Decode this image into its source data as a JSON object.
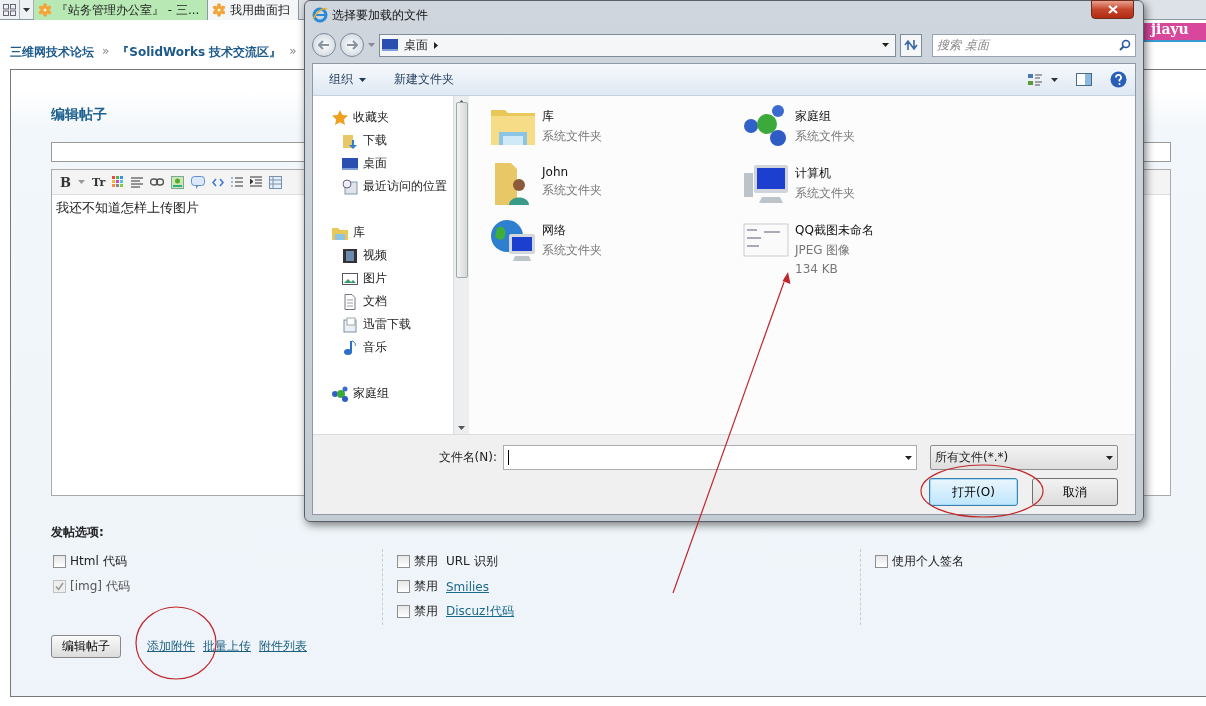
{
  "browser_tabs": [
    {
      "label": "『站务管理办公室』 - 三...",
      "selected": true
    },
    {
      "label": "我用曲面扫",
      "selected": false
    }
  ],
  "banner": {
    "text": "jiayu"
  },
  "breadcrumb": {
    "items": [
      "三维网技术论坛",
      "『SolidWorks 技术交流区』"
    ],
    "separator": "»"
  },
  "editor": {
    "title": "编辑帖子",
    "toolbar_labels": [
      "B",
      "Tr"
    ],
    "content": "我还不知道怎样上传图片"
  },
  "options": {
    "heading": "发帖选项:",
    "columns": [
      [
        {
          "label": "Html 代码",
          "checked": false,
          "disabled": false,
          "link": false
        },
        {
          "label": "[img] 代码",
          "checked": true,
          "disabled": true,
          "link": false
        }
      ],
      [
        {
          "prefix": "禁用",
          "label": "URL 识别",
          "checked": false,
          "disabled": false,
          "link": false
        },
        {
          "prefix": "禁用",
          "label": "Smilies",
          "checked": false,
          "disabled": false,
          "link": true
        },
        {
          "prefix": "禁用",
          "label": "Discuz!代码",
          "checked": false,
          "disabled": false,
          "link": true
        }
      ],
      [
        {
          "label": "使用个人签名",
          "checked": false,
          "disabled": false,
          "link": false
        }
      ]
    ]
  },
  "submit_button": "编辑帖子",
  "attachment_links": [
    "添加附件",
    "批量上传",
    "附件列表"
  ],
  "dialog": {
    "title": "选择要加载的文件",
    "address": "桌面",
    "search_placeholder": "搜索 桌面",
    "toolbar": [
      {
        "label": "组织",
        "menu": true
      },
      {
        "label": "新建文件夹",
        "menu": false
      }
    ],
    "nav": [
      {
        "label": "收藏夹",
        "kind": "favorites",
        "children": [
          {
            "label": "下载",
            "kind": "download"
          },
          {
            "label": "桌面",
            "kind": "desktop"
          },
          {
            "label": "最近访问的位置",
            "kind": "recent"
          }
        ]
      },
      {
        "label": "库",
        "kind": "library",
        "children": [
          {
            "label": "视频",
            "kind": "video"
          },
          {
            "label": "图片",
            "kind": "pictures"
          },
          {
            "label": "文档",
            "kind": "documents"
          },
          {
            "label": "迅雷下载",
            "kind": "downloads-library"
          },
          {
            "label": "音乐",
            "kind": "music"
          }
        ]
      },
      {
        "label": "家庭组",
        "kind": "homegroup"
      }
    ],
    "files": [
      {
        "name": "库",
        "details": [
          "系统文件夹"
        ],
        "kind": "library"
      },
      {
        "name": "家庭组",
        "details": [
          "系统文件夹"
        ],
        "kind": "homegroup"
      },
      {
        "name": "John",
        "details": [
          "系统文件夹"
        ],
        "kind": "user"
      },
      {
        "name": "计算机",
        "details": [
          "系统文件夹"
        ],
        "kind": "computer"
      },
      {
        "name": "网络",
        "details": [
          "系统文件夹"
        ],
        "kind": "network"
      },
      {
        "name": "QQ截图未命名",
        "details": [
          "JPEG 图像",
          "134 KB"
        ],
        "kind": "image"
      }
    ],
    "filename_label": "文件名(N):",
    "filter": "所有文件(*.*)",
    "buttons": [
      {
        "label": "打开(O)",
        "default": true
      },
      {
        "label": "取消",
        "default": false
      }
    ]
  }
}
